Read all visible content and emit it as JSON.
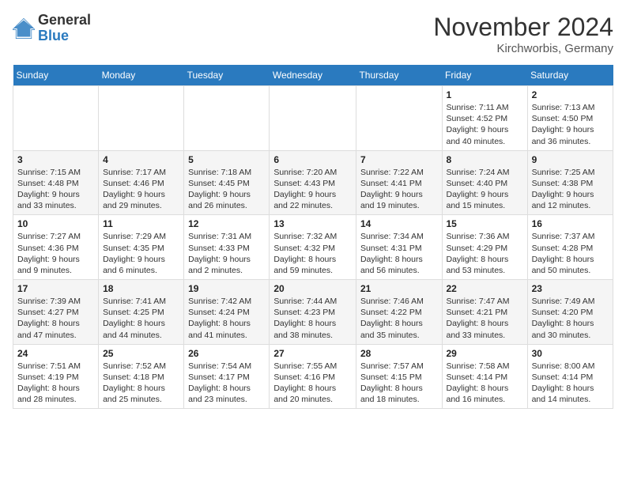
{
  "logo": {
    "line1": "General",
    "line2": "Blue"
  },
  "title": "November 2024",
  "location": "Kirchworbis, Germany",
  "days_header": [
    "Sunday",
    "Monday",
    "Tuesday",
    "Wednesday",
    "Thursday",
    "Friday",
    "Saturday"
  ],
  "weeks": [
    [
      {
        "day": "",
        "info": ""
      },
      {
        "day": "",
        "info": ""
      },
      {
        "day": "",
        "info": ""
      },
      {
        "day": "",
        "info": ""
      },
      {
        "day": "",
        "info": ""
      },
      {
        "day": "1",
        "info": "Sunrise: 7:11 AM\nSunset: 4:52 PM\nDaylight: 9 hours\nand 40 minutes."
      },
      {
        "day": "2",
        "info": "Sunrise: 7:13 AM\nSunset: 4:50 PM\nDaylight: 9 hours\nand 36 minutes."
      }
    ],
    [
      {
        "day": "3",
        "info": "Sunrise: 7:15 AM\nSunset: 4:48 PM\nDaylight: 9 hours\nand 33 minutes."
      },
      {
        "day": "4",
        "info": "Sunrise: 7:17 AM\nSunset: 4:46 PM\nDaylight: 9 hours\nand 29 minutes."
      },
      {
        "day": "5",
        "info": "Sunrise: 7:18 AM\nSunset: 4:45 PM\nDaylight: 9 hours\nand 26 minutes."
      },
      {
        "day": "6",
        "info": "Sunrise: 7:20 AM\nSunset: 4:43 PM\nDaylight: 9 hours\nand 22 minutes."
      },
      {
        "day": "7",
        "info": "Sunrise: 7:22 AM\nSunset: 4:41 PM\nDaylight: 9 hours\nand 19 minutes."
      },
      {
        "day": "8",
        "info": "Sunrise: 7:24 AM\nSunset: 4:40 PM\nDaylight: 9 hours\nand 15 minutes."
      },
      {
        "day": "9",
        "info": "Sunrise: 7:25 AM\nSunset: 4:38 PM\nDaylight: 9 hours\nand 12 minutes."
      }
    ],
    [
      {
        "day": "10",
        "info": "Sunrise: 7:27 AM\nSunset: 4:36 PM\nDaylight: 9 hours\nand 9 minutes."
      },
      {
        "day": "11",
        "info": "Sunrise: 7:29 AM\nSunset: 4:35 PM\nDaylight: 9 hours\nand 6 minutes."
      },
      {
        "day": "12",
        "info": "Sunrise: 7:31 AM\nSunset: 4:33 PM\nDaylight: 9 hours\nand 2 minutes."
      },
      {
        "day": "13",
        "info": "Sunrise: 7:32 AM\nSunset: 4:32 PM\nDaylight: 8 hours\nand 59 minutes."
      },
      {
        "day": "14",
        "info": "Sunrise: 7:34 AM\nSunset: 4:31 PM\nDaylight: 8 hours\nand 56 minutes."
      },
      {
        "day": "15",
        "info": "Sunrise: 7:36 AM\nSunset: 4:29 PM\nDaylight: 8 hours\nand 53 minutes."
      },
      {
        "day": "16",
        "info": "Sunrise: 7:37 AM\nSunset: 4:28 PM\nDaylight: 8 hours\nand 50 minutes."
      }
    ],
    [
      {
        "day": "17",
        "info": "Sunrise: 7:39 AM\nSunset: 4:27 PM\nDaylight: 8 hours\nand 47 minutes."
      },
      {
        "day": "18",
        "info": "Sunrise: 7:41 AM\nSunset: 4:25 PM\nDaylight: 8 hours\nand 44 minutes."
      },
      {
        "day": "19",
        "info": "Sunrise: 7:42 AM\nSunset: 4:24 PM\nDaylight: 8 hours\nand 41 minutes."
      },
      {
        "day": "20",
        "info": "Sunrise: 7:44 AM\nSunset: 4:23 PM\nDaylight: 8 hours\nand 38 minutes."
      },
      {
        "day": "21",
        "info": "Sunrise: 7:46 AM\nSunset: 4:22 PM\nDaylight: 8 hours\nand 35 minutes."
      },
      {
        "day": "22",
        "info": "Sunrise: 7:47 AM\nSunset: 4:21 PM\nDaylight: 8 hours\nand 33 minutes."
      },
      {
        "day": "23",
        "info": "Sunrise: 7:49 AM\nSunset: 4:20 PM\nDaylight: 8 hours\nand 30 minutes."
      }
    ],
    [
      {
        "day": "24",
        "info": "Sunrise: 7:51 AM\nSunset: 4:19 PM\nDaylight: 8 hours\nand 28 minutes."
      },
      {
        "day": "25",
        "info": "Sunrise: 7:52 AM\nSunset: 4:18 PM\nDaylight: 8 hours\nand 25 minutes."
      },
      {
        "day": "26",
        "info": "Sunrise: 7:54 AM\nSunset: 4:17 PM\nDaylight: 8 hours\nand 23 minutes."
      },
      {
        "day": "27",
        "info": "Sunrise: 7:55 AM\nSunset: 4:16 PM\nDaylight: 8 hours\nand 20 minutes."
      },
      {
        "day": "28",
        "info": "Sunrise: 7:57 AM\nSunset: 4:15 PM\nDaylight: 8 hours\nand 18 minutes."
      },
      {
        "day": "29",
        "info": "Sunrise: 7:58 AM\nSunset: 4:14 PM\nDaylight: 8 hours\nand 16 minutes."
      },
      {
        "day": "30",
        "info": "Sunrise: 8:00 AM\nSunset: 4:14 PM\nDaylight: 8 hours\nand 14 minutes."
      }
    ]
  ]
}
